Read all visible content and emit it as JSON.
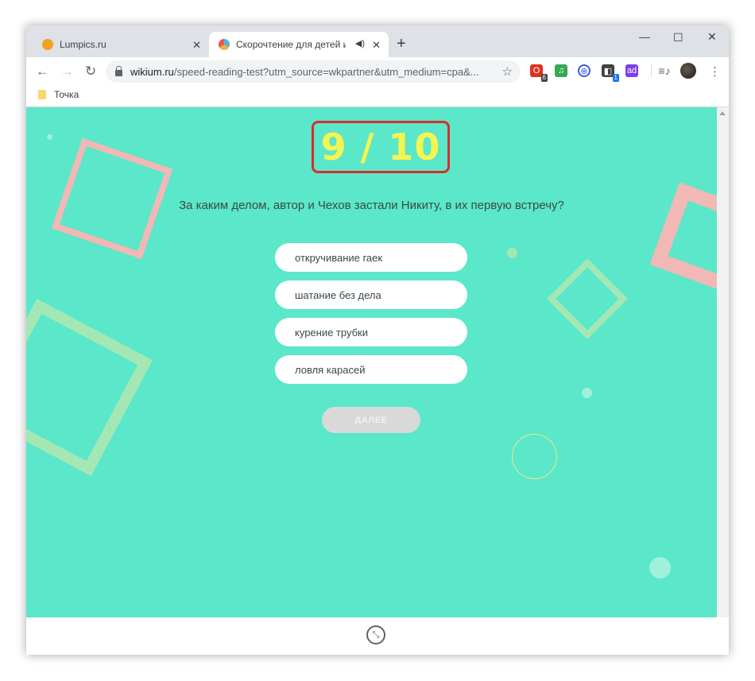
{
  "browser": {
    "tabs": [
      {
        "title": "Lumpics.ru",
        "active": false
      },
      {
        "title": "Скорочтение для детей и взрослых",
        "active": true
      }
    ],
    "new_tab_label": "+",
    "url": {
      "domain": "wikium.ru",
      "path": "/speed-reading-test?utm_source=wkpartner&utm_medium=cpa&..."
    },
    "bookmarks": [
      {
        "label": "Точка"
      }
    ],
    "extensions": [
      {
        "name": "opera-extension-icon",
        "color": "#e0301e",
        "badge": "6"
      },
      {
        "name": "music-extension-icon",
        "color": "#34a853"
      },
      {
        "name": "vpn-globe-extension-icon",
        "color": "#3b5bdb"
      },
      {
        "name": "cube-extension-icon",
        "color": "#3c4043",
        "badge": "1"
      },
      {
        "name": "ad-extension-icon",
        "color": "#7b3fe4"
      }
    ]
  },
  "quiz": {
    "counter": "9 / 10",
    "question": "За каким делом, автор и Чехов застали Никиту, в их первую встречу?",
    "answers": [
      {
        "label": "откручивание гаек"
      },
      {
        "label": "шатание без дела"
      },
      {
        "label": "курение трубки"
      },
      {
        "label": "ловля карасей"
      }
    ],
    "next_label": "ДАЛЕЕ"
  },
  "colors": {
    "background": "#5be7c9",
    "counter_text": "#f5f451",
    "highlight_border": "#d92d2d",
    "button_disabled": "#d9d9d9"
  }
}
